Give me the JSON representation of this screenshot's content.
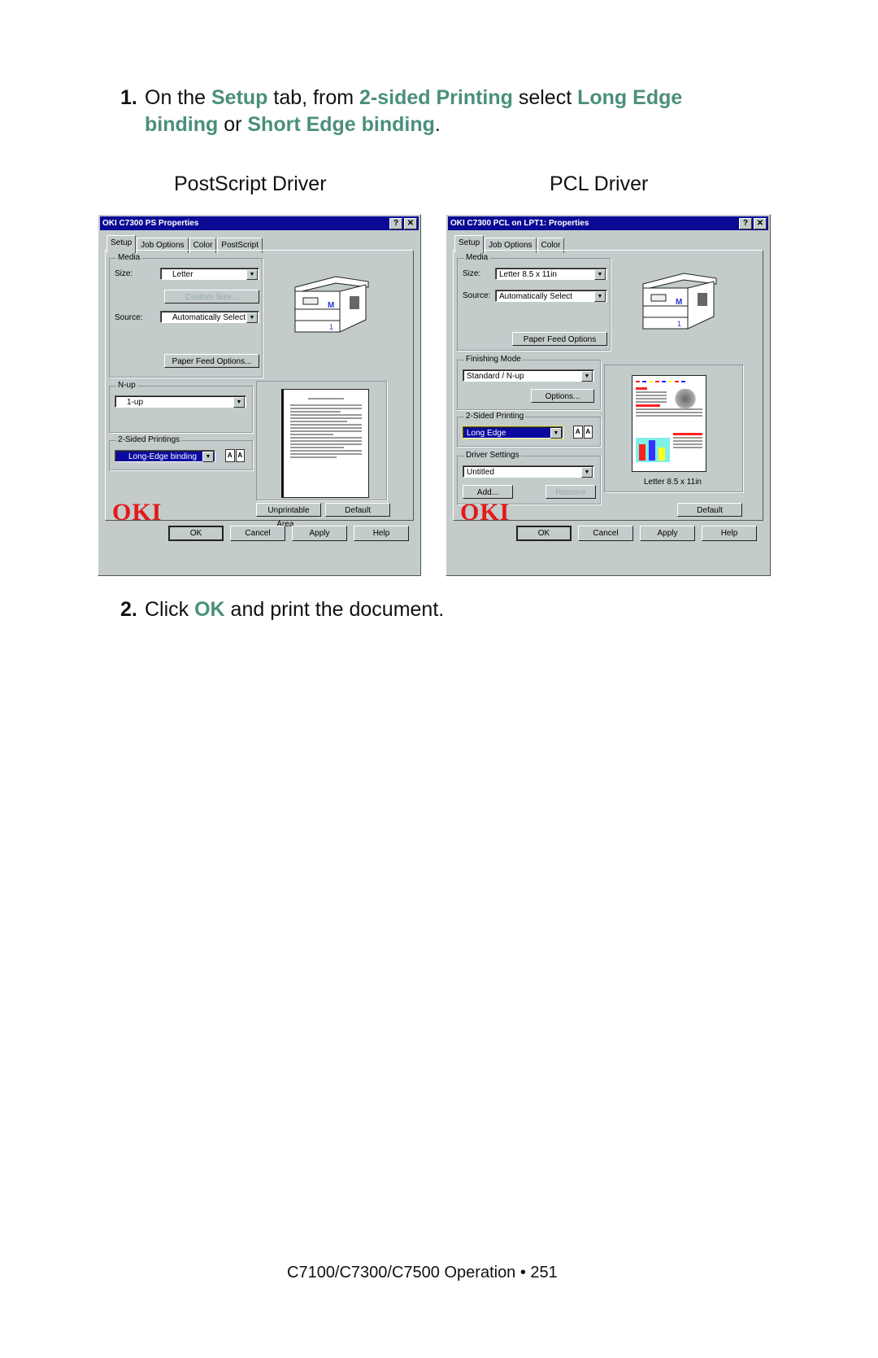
{
  "step1": {
    "number": "1.",
    "t1": "On the ",
    "h1": "Setup",
    "t2": " tab, from ",
    "h2": "2-sided Printing",
    "t3": " select ",
    "h3": "Long Edge",
    "h3b": "binding",
    "t4": " or ",
    "h4": "Short Edge binding",
    "t5": "."
  },
  "captions": {
    "ps": "PostScript Driver",
    "pcl": "PCL Driver"
  },
  "ps_dialog": {
    "title": "OKI C7300 PS Properties",
    "help_btn": "?",
    "close_btn": "✕",
    "tabs": [
      "Setup",
      "Job Options",
      "Color",
      "PostScript"
    ],
    "media_label": "Media",
    "size_label": "Size:",
    "size_value": "Letter",
    "custom_size_btn": "Custom Size...",
    "source_label": "Source:",
    "source_value": "Automatically Select",
    "paper_feed_btn": "Paper Feed Options...",
    "nup_label": "N-up",
    "nup_value": "1-up",
    "duplex_label": "2-Sided Printings",
    "duplex_value": "Long-Edge binding",
    "unprintable_btn": "Unprintable Area...",
    "default_btn": "Default",
    "logo": "OKI",
    "ok_btn": "OK",
    "cancel_btn": "Cancel",
    "apply_btn": "Apply",
    "help_button": "Help"
  },
  "pcl_dialog": {
    "title": "OKI C7300 PCL on LPT1: Properties",
    "help_btn": "?",
    "close_btn": "✕",
    "tabs": [
      "Setup",
      "Job Options",
      "Color"
    ],
    "media_label": "Media",
    "size_label": "Size:",
    "size_value": "Letter 8.5 x 11in",
    "source_label": "Source:",
    "source_value": "Automatically Select",
    "paper_feed_btn": "Paper Feed Options",
    "finishing_label": "Finishing Mode",
    "finishing_value": "Standard / N-up",
    "options_btn": "Options...",
    "duplex_label": "2-Sided Printing",
    "duplex_value": "Long Edge",
    "driver_settings_label": "Driver Settings",
    "driver_settings_value": "Untitled",
    "add_btn": "Add...",
    "remove_btn": "Remove",
    "paper_caption": "Letter 8.5 x 11in",
    "default_btn": "Default",
    "logo": "OKI",
    "ok_btn": "OK",
    "cancel_btn": "Cancel",
    "apply_btn": "Apply",
    "help_button": "Help"
  },
  "printer_labels": {
    "tray_m": "M",
    "tray_1": "1"
  },
  "step2": {
    "number": "2.",
    "t1": "Click ",
    "h1": "OK",
    "t2": " and print the document."
  },
  "footer": "C7100/C7300/C7500  Operation • 251"
}
